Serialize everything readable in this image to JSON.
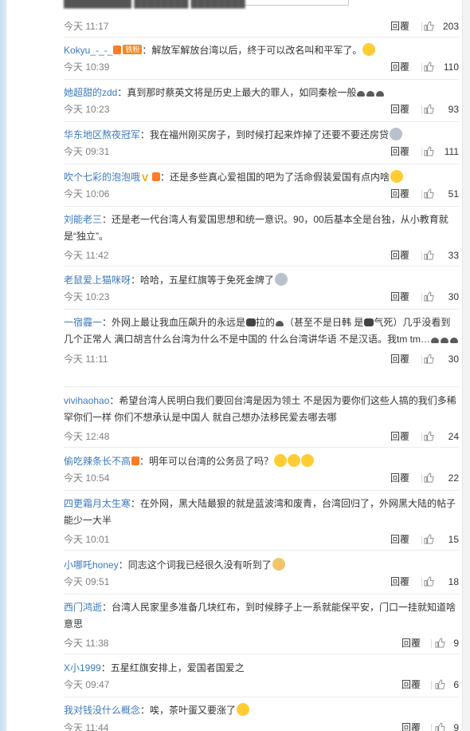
{
  "labels": {
    "reply": "回覆"
  },
  "top_partial": {
    "text": "...",
    "time": "今天 11:17",
    "likes": "203"
  },
  "comments": [
    {
      "user": "Kokyu_-_-_",
      "badge": "铁粉",
      "text": "：解放军解放台湾以后，终于可以改名叫和平军了。",
      "time": "今天 10:39",
      "likes": "110"
    },
    {
      "user": "她超甜的zdd",
      "text": "：真到那时蔡英文将是历史上最大的罪人，如同秦桧一般",
      "time": "今天 10:23",
      "likes": "93"
    },
    {
      "user": "华东地区熬夜冠军",
      "text": "：我在福州刚买房子，到时候打起来炸掉了还要不要还房贷",
      "time": "今天 09:31",
      "likes": "111"
    },
    {
      "user": "吹个七彩的泡泡哦",
      "text": "：还是多些真心爱祖国的吧为了活命假装爱国有点内啥",
      "time": "今天 10:06",
      "likes": "51"
    },
    {
      "user": "刘能老三",
      "text": "：还是老一代台湾人有爱国思想和统一意识。90，00后基本全是台独，从小教育就是“独立”。",
      "time": "今天 11:42",
      "likes": "33"
    },
    {
      "user": "老鼠爱上猫咪呀",
      "text": "：哈哈，五星红旗等于免死金牌了",
      "time": "今天 10:23",
      "likes": "30"
    },
    {
      "user": "一宿霾一",
      "text_a": "：外网上最让我血压飙升的永远是",
      "text_b": "拉的",
      "text_c": "（甚至不是日韩 是",
      "text_d": "气死）几乎没看到几个正常人 满口胡言什么台湾为什么不是中国的 什么台湾讲华语 不是汉语。我tm tm…",
      "time": "今天 11:11",
      "likes": "30"
    },
    {
      "user": "vivihaohao",
      "text": "：希望台湾人民明白我们要回台湾是因为领土 不是因为要你们这些人搞的我们多稀罕你们一样 你们不想承认是中国人 就自己想办法移民爱去哪去哪",
      "time": "今天 12:48",
      "likes": "24"
    },
    {
      "user": "偷吃辣条长不高",
      "text": "：明年可以台湾的公务员了吗？",
      "time": "今天 10:54",
      "likes": "22"
    },
    {
      "user": "四更霜月太生寒",
      "text": "：在外网，黑大陆最狠的就是蓝波湾和废青，台湾回归了，外网黑大陆的帖子能少一大半",
      "time": "今天 10:01",
      "likes": "15"
    },
    {
      "user": "小哪吒honey",
      "text": "：同志这个词我已经很久没有听到了",
      "time": "今天 09:51",
      "likes": "18"
    },
    {
      "user": "西门鸿逝",
      "text": "：台湾人民家里多准备几块红布，到时候脖子上一系就能保平安，门口一挂就知道啥意思",
      "time": "今天 11:38",
      "likes": "9"
    },
    {
      "user": "X小1999",
      "text": "：五星红旗安排上，爱国者国爱之",
      "time": "今天 09:47",
      "likes": "6"
    },
    {
      "user": "我对钱没什么概念",
      "text": "：唉，茶叶蛋又要涨了",
      "time": "今天 11:44",
      "likes": "9"
    }
  ]
}
